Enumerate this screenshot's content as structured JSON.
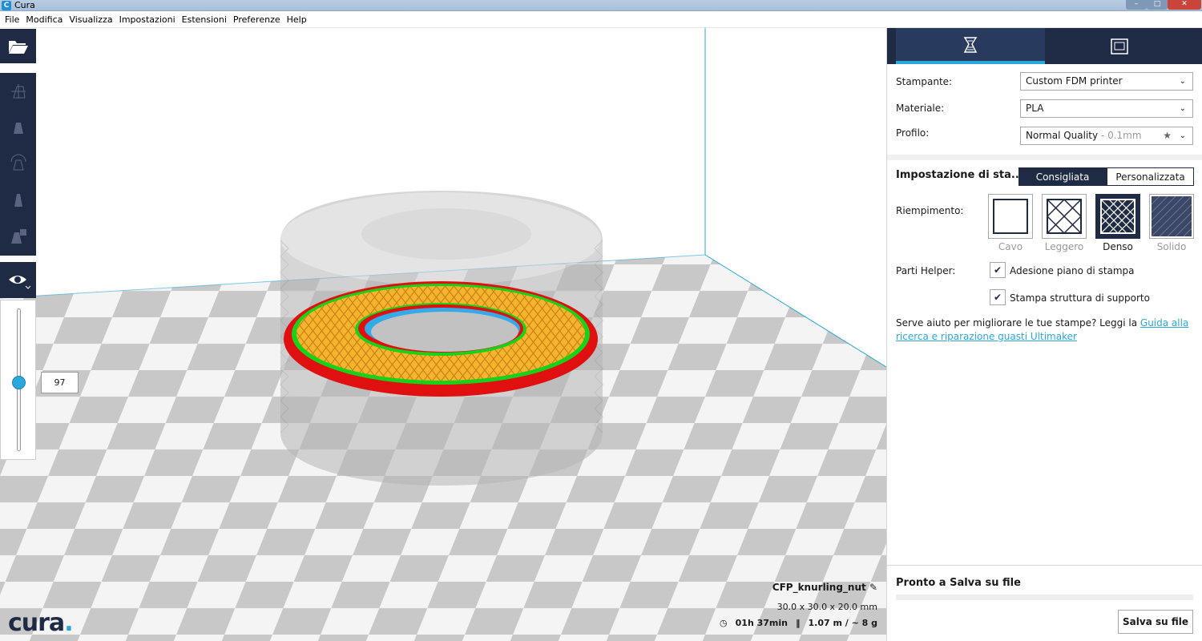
{
  "window": {
    "title": "Cura",
    "app_icon": "C"
  },
  "menu": [
    "File",
    "Modifica",
    "Visualizza",
    "Impostazioni",
    "Estensioni",
    "Preferenze",
    "Help"
  ],
  "layer_view": {
    "current_layer": "97",
    "slider_fraction": 0.5
  },
  "logo": {
    "text": "cura",
    "dot": "."
  },
  "object": {
    "name": "CFP_knurling_nut",
    "dimensions": "30.0 x 30.0 x 20.0 mm",
    "print_time": "01h 37min",
    "material_usage": "1.07 m / ~ 8 g"
  },
  "sidebar": {
    "printer_label": "Stampante:",
    "printer_value": "Custom FDM printer",
    "material_label": "Materiale:",
    "material_value": "PLA",
    "profile_label": "Profilo:",
    "profile_value": "Normal Quality",
    "profile_sub": " - 0.1mm",
    "settings_heading": "Impostazione di sta...",
    "mode_recommended": "Consigliata",
    "mode_custom": "Personalizzata",
    "infill_label": "Riempimento:",
    "infill_options": [
      "Cavo",
      "Leggero",
      "Denso",
      "Solido"
    ],
    "infill_selected": "Denso",
    "helper_label": "Parti Helper:",
    "adhesion_label": "Adesione piano di stampa",
    "support_label": "Stampa struttura di supporto",
    "help_text": "Serve aiuto per migliorare le tue stampe? Leggi la ",
    "help_link": "Guida alla ricerca e riparazione guasti Ultimaker",
    "status": "Pronto a Salva su file",
    "save_button": "Salva su file"
  },
  "colors": {
    "dark": "#1f2a45",
    "accent": "#2aa8dc",
    "infill": "#f6b42c",
    "wall": "#e01010",
    "inner": "#19d119"
  }
}
